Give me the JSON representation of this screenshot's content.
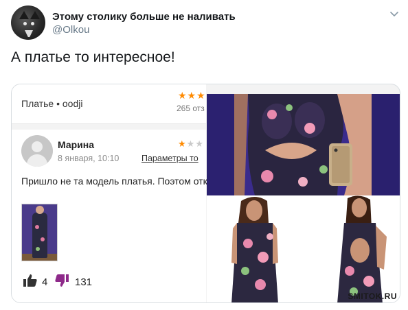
{
  "tweet": {
    "display_name": "Этому столику больше не наливать",
    "handle": "@Olkou",
    "text": "А платье то интересное!",
    "menu_icon": "chevron-down-icon"
  },
  "review_screenshot": {
    "product_title": "Платье • oodji",
    "product_stars": "★★★",
    "reviews_count": "265 отз",
    "reviewer_name": "Марина",
    "review_date": "8 января, 10:10",
    "review_stars_on": "★",
    "review_stars_off": "★★",
    "params_link": "Параметры то",
    "review_text": "Пришло не та модель платья. Поэтом отказ",
    "likes": "4",
    "dislikes": "131",
    "star_color": "#ff8a00"
  },
  "watermark": "SMITOK.RU"
}
